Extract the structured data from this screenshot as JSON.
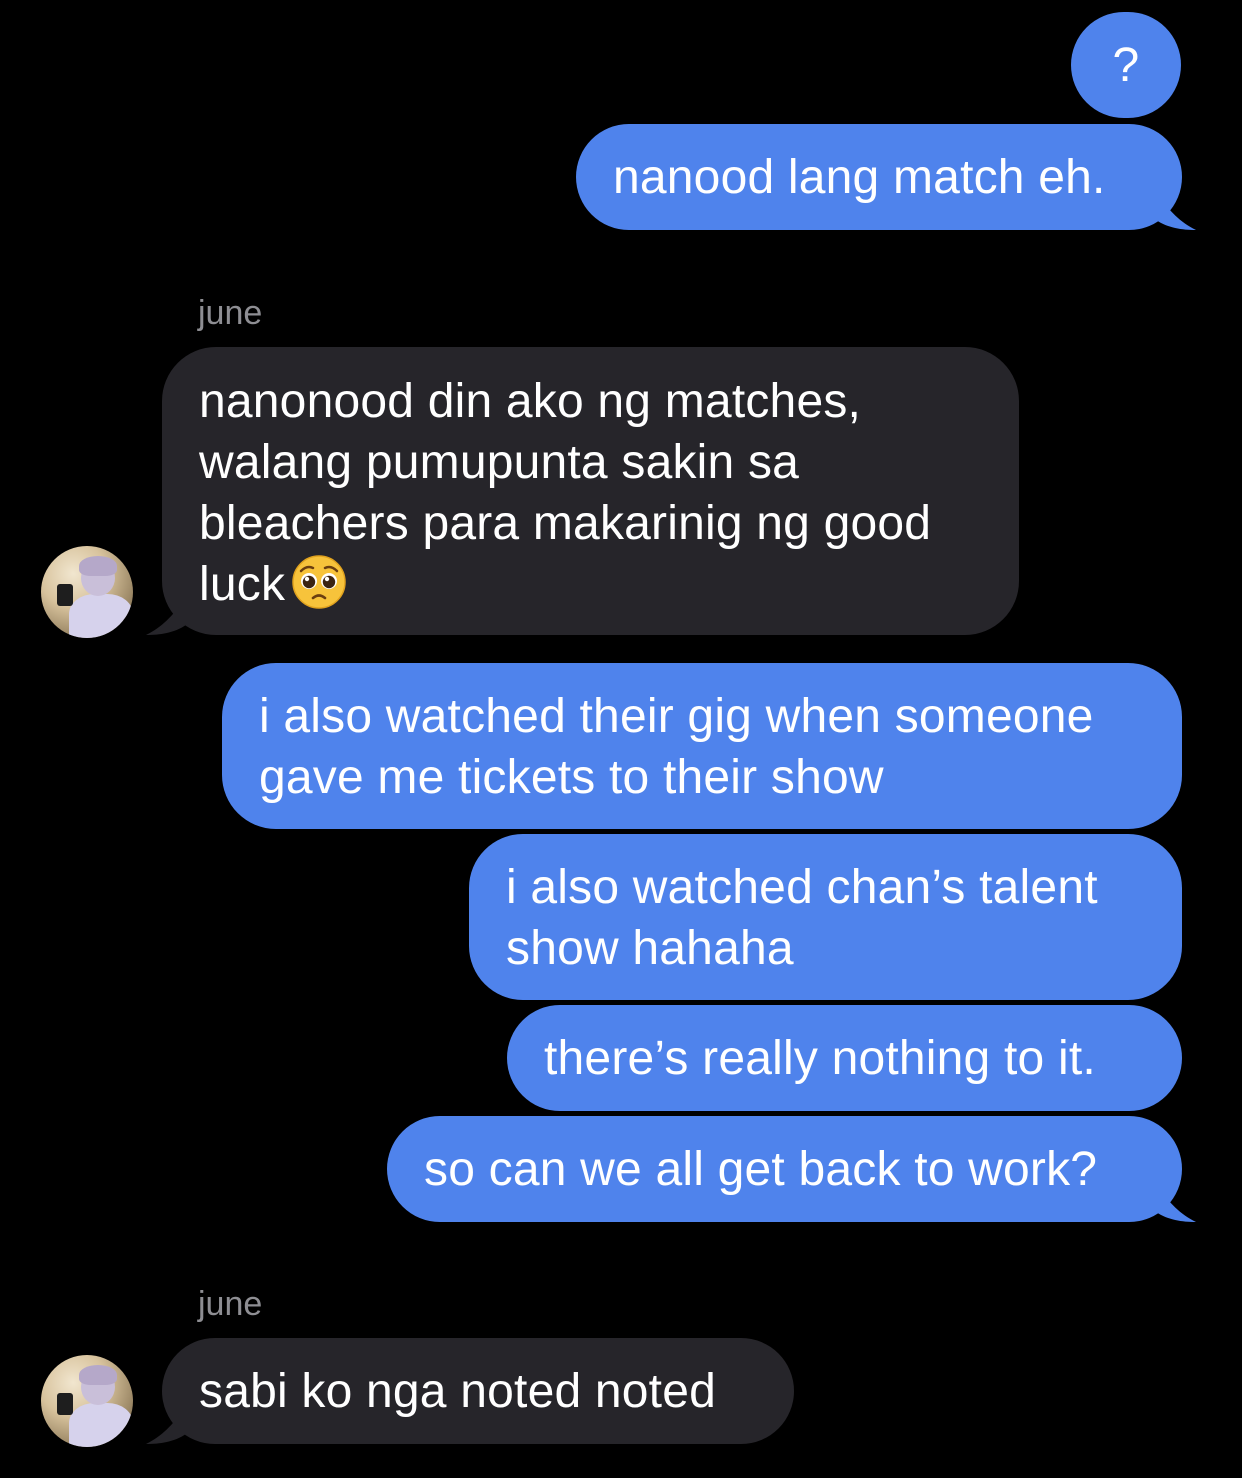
{
  "thread": {
    "messages": [
      {
        "id": "m1",
        "from": "me",
        "text": "?"
      },
      {
        "id": "m2",
        "from": "me",
        "text": "nanood lang match eh."
      },
      {
        "id": "m3",
        "from": "june",
        "sender_label": "june",
        "lines": [
          "nanonood din ako ng matches,",
          "walang pumupunta sakin sa",
          "bleachers para makarinig ng good",
          "luck"
        ],
        "emoji": "pleading-face"
      },
      {
        "id": "m4",
        "from": "me",
        "lines": [
          "i also watched their gig when someone",
          "gave me tickets to their show"
        ]
      },
      {
        "id": "m5",
        "from": "me",
        "lines": [
          "i also watched chan’s talent",
          "show hahaha"
        ]
      },
      {
        "id": "m6",
        "from": "me",
        "text": "there’s really nothing to it."
      },
      {
        "id": "m7",
        "from": "me",
        "text": "so can we all get back to work?"
      },
      {
        "id": "m8",
        "from": "june",
        "sender_label": "june",
        "text": "sabi ko nga noted noted"
      }
    ]
  },
  "colors": {
    "background": "#000000",
    "outgoing_bubble": "#4f83ec",
    "incoming_bubble": "#26252a",
    "sender_label": "#8e8e93",
    "text": "#ffffff"
  }
}
